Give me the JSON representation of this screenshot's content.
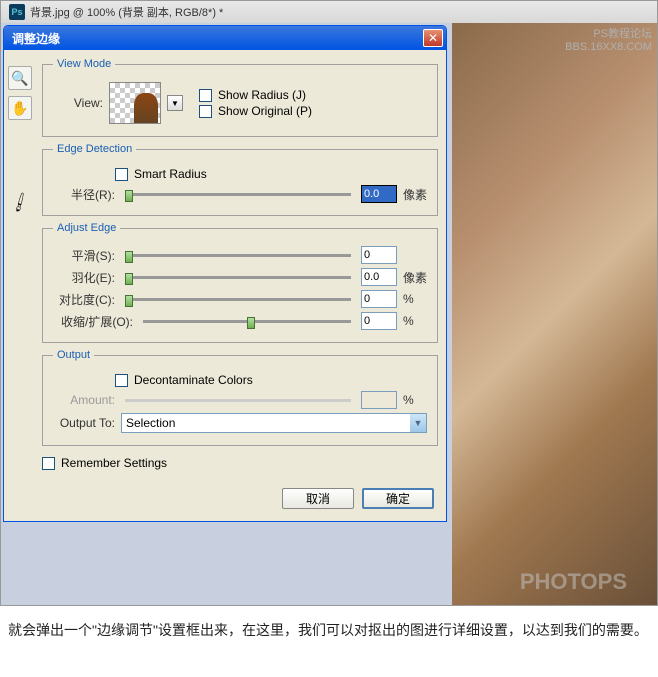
{
  "main_titlebar": "背景.jpg @ 100% (背景 副本, RGB/8*) *",
  "watermark_top_line1": "PS教程论坛",
  "watermark_top_line2": "BBS.16XX8.COM",
  "watermark_bottom": "PHOTOPS",
  "dialog": {
    "title": "调整边缘",
    "view_mode": {
      "legend": "View Mode",
      "view_label": "View:",
      "show_radius": "Show Radius (J)",
      "show_original": "Show Original (P)"
    },
    "edge_detection": {
      "legend": "Edge Detection",
      "smart_radius": "Smart Radius",
      "radius_label": "半径(R):",
      "radius_value": "0.0",
      "radius_unit": "像素"
    },
    "adjust_edge": {
      "legend": "Adjust Edge",
      "smooth_label": "平滑(S):",
      "smooth_value": "0",
      "feather_label": "羽化(E):",
      "feather_value": "0.0",
      "feather_unit": "像素",
      "contrast_label": "对比度(C):",
      "contrast_value": "0",
      "contrast_unit": "%",
      "shift_label": "收缩/扩展(O):",
      "shift_value": "0",
      "shift_unit": "%"
    },
    "output": {
      "legend": "Output",
      "decontaminate": "Decontaminate Colors",
      "amount_label": "Amount:",
      "amount_value": "",
      "amount_unit": "%",
      "output_to_label": "Output To:",
      "output_to_value": "Selection"
    },
    "remember_settings": "Remember Settings",
    "cancel": "取消",
    "ok": "确定"
  },
  "caption": "就会弹出一个\"边缘调节\"设置框出来，在这里，我们可以对抠出的图进行详细设置，以达到我们的需要。"
}
